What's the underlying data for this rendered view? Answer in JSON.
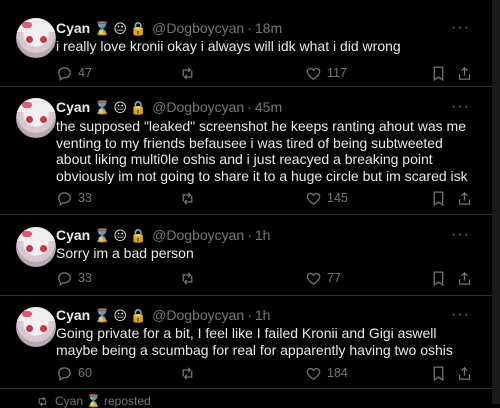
{
  "tweets": [
    {
      "name": "Cyan",
      "badges": [
        "⌛",
        "😐",
        "🔒"
      ],
      "handle": "@Dogboycyan",
      "dot": "·",
      "time": "18m",
      "text": "i really love kronii okay i always will idk what i did wrong",
      "replies": "47",
      "retweets": "",
      "likes": "117"
    },
    {
      "name": "Cyan",
      "badges": [
        "⌛",
        "😐",
        "🔒"
      ],
      "handle": "@Dogboycyan",
      "dot": "·",
      "time": "45m",
      "text": "the supposed \"leaked\" screenshot he keeps ranting ahout was me venting to my friends befausee i was tired of being subtweeted about liking multi0le oshis and i just reacyed a breaking point obviously im not going to share it to a huge circle but im scared isk",
      "replies": "33",
      "retweets": "",
      "likes": "145"
    },
    {
      "name": "Cyan",
      "badges": [
        "⌛",
        "😐",
        "🔒"
      ],
      "handle": "@Dogboycyan",
      "dot": "·",
      "time": "1h",
      "text": "Sorry im a bad person",
      "replies": "33",
      "retweets": "",
      "likes": "77"
    },
    {
      "name": "Cyan",
      "badges": [
        "⌛",
        "😐",
        "🔒"
      ],
      "handle": "@Dogboycyan",
      "dot": "·",
      "time": "1h",
      "text": "Going private for a bit, I feel like I failed Kronii and Gigi aswell maybe being a scumbag for real for apparently having two oshis",
      "replies": "60",
      "retweets": "",
      "likes": "184"
    }
  ],
  "more_label": "···",
  "bottom": {
    "retweet_icon": "repost-icon",
    "name": "Cyan",
    "badge": "⌛",
    "label": "reposted"
  }
}
